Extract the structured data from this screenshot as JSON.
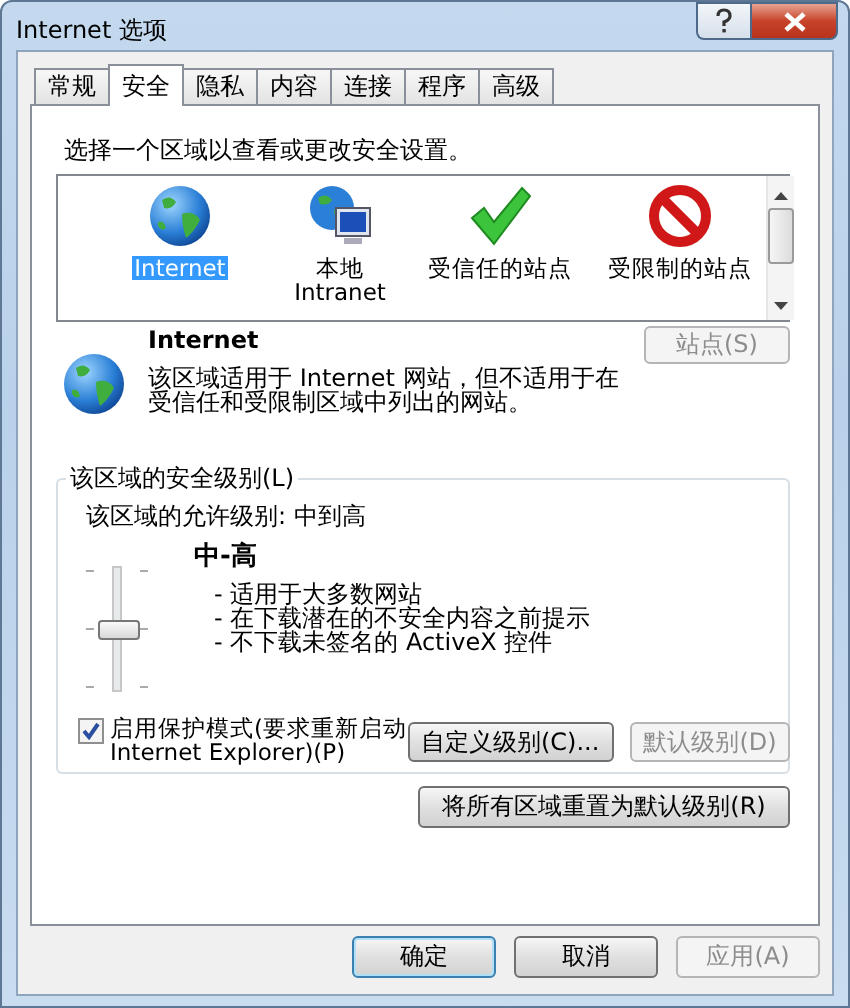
{
  "window": {
    "title": "Internet 选项"
  },
  "tabs": [
    {
      "label": "常规",
      "selected": false
    },
    {
      "label": "安全",
      "selected": true
    },
    {
      "label": "隐私",
      "selected": false
    },
    {
      "label": "内容",
      "selected": false
    },
    {
      "label": "连接",
      "selected": false
    },
    {
      "label": "程序",
      "selected": false
    },
    {
      "label": "高级",
      "selected": false
    }
  ],
  "instruction": "选择一个区域以查看或更改安全设置。",
  "zones": [
    {
      "kind": "globe",
      "label": "Internet",
      "selected": true
    },
    {
      "kind": "intranet",
      "label": "本地\nIntranet",
      "selected": false
    },
    {
      "kind": "trusted",
      "label": "受信任的站点",
      "selected": false
    },
    {
      "kind": "restricted",
      "label": "受限制的站点",
      "selected": false
    }
  ],
  "zone_info": {
    "title": "Internet",
    "description": "该区域适用于 Internet 网站，但不适用于在受信任和受限制区域中列出的网站。",
    "sites_button": {
      "label": "站点(S)",
      "disabled": true
    }
  },
  "security_level": {
    "legend": "该区域的安全级别(L)",
    "allowed": "该区域的允许级别: 中到高",
    "level_name": "中-高",
    "level": 0.5,
    "bullets": [
      "- 适用于大多数网站",
      "- 在下载潜在的不安全内容之前提示",
      "- 不下载未签名的 ActiveX 控件"
    ],
    "protected_mode": {
      "label": "启用保护模式(要求重新启动\nInternet Explorer)(P)",
      "checked": true
    },
    "buttons": [
      {
        "label": "自定义级别(C)...",
        "disabled": false
      },
      {
        "label": "默认级别(D)",
        "disabled": true
      }
    ]
  },
  "reset_button": {
    "label": "将所有区域重置为默认级别(R)",
    "disabled": false
  },
  "dialog_buttons": [
    {
      "label": "确定",
      "disabled": false,
      "default": true
    },
    {
      "label": "取消",
      "disabled": false,
      "default": false
    },
    {
      "label": "应用(A)",
      "disabled": true,
      "default": false
    }
  ]
}
